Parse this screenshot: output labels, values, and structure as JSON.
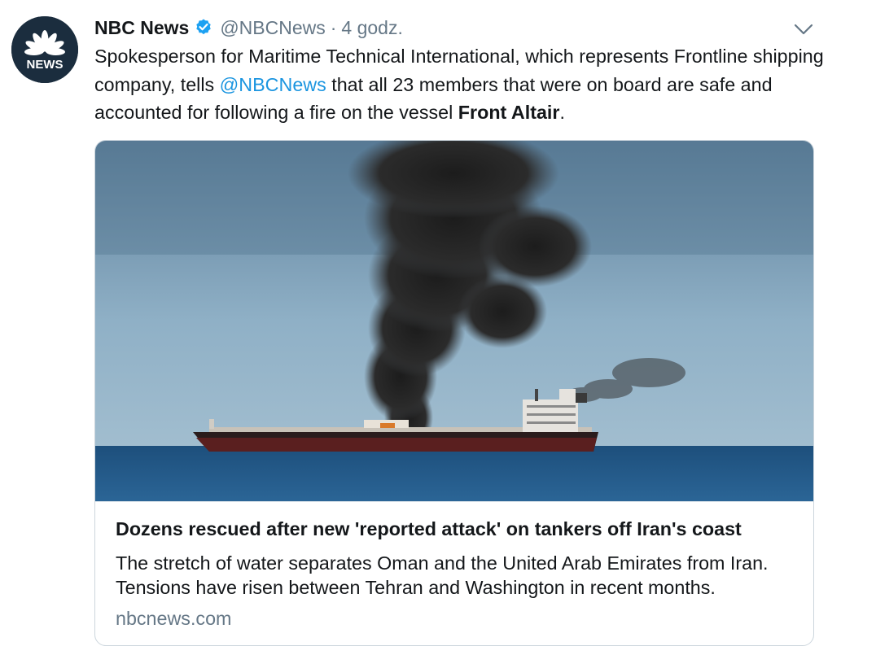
{
  "tweet": {
    "display_name": "NBC News",
    "handle": "@NBCNews",
    "separator": "·",
    "timestamp": "4 godz.",
    "verified_icon": "verified-badge",
    "menu_icon": "chevron-down-icon",
    "avatar_label": "NEWS",
    "text_part1": "Spokesperson for Maritime Technical International, which represents Frontline shipping company, tells ",
    "mention": "@NBCNews",
    "text_part2": "  that all 23 members that were on board are safe and accounted for following a fire on the vessel ",
    "bold_text": "Front Altair",
    "text_part3": "."
  },
  "card": {
    "title": "Dozens rescued after new 'reported attack' on tankers off Iran's coast",
    "description": "The stretch of water separates Oman and the United Arab Emirates from Iran. Tensions have risen between Tehran and Washington in recent months.",
    "domain": "nbcnews.com"
  },
  "colors": {
    "link": "#1b95e0",
    "secondary_text": "#657786",
    "verified": "#1da1f2",
    "border": "#ccd6dd"
  }
}
